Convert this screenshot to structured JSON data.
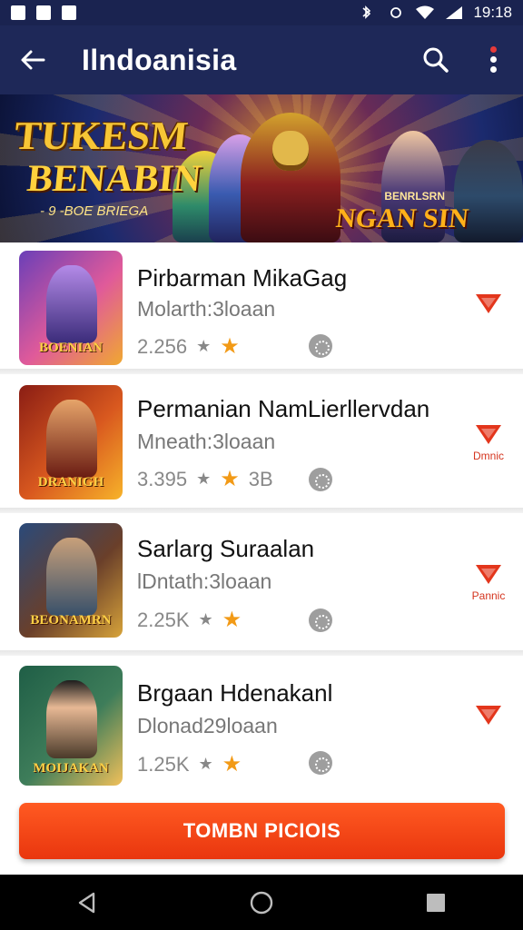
{
  "status_bar": {
    "time": "19:18"
  },
  "app_bar": {
    "title": "Ilndoanisia"
  },
  "banner": {
    "title_line1": "TUKESM",
    "title_line2": "BENABIN",
    "subtitle": "- 9 -BOE BRIEGA",
    "badge_small": "BENRLSRN",
    "badge_large": "NGAN SIN"
  },
  "games": [
    {
      "title": "Pirbarman MikaGag",
      "subtitle": "Molarth:3loaan",
      "rating": "2.256",
      "extra": "",
      "thumb_label": "BOENIAN",
      "tag_label": "",
      "colors": [
        "#6a3fb8",
        "#e05a9a",
        "#f0a830"
      ]
    },
    {
      "title": "Permanian NamLierllervdan",
      "subtitle": "Mneath:3loaan",
      "rating": "3.395",
      "extra": "3B",
      "thumb_label": "DRANIGH",
      "tag_label": "Dmnic",
      "colors": [
        "#8a1d14",
        "#d9591f",
        "#f7b32a"
      ]
    },
    {
      "title": "Sarlarg Suraalan",
      "subtitle": "lDntath:3loaan",
      "rating": "2.25K",
      "extra": "",
      "thumb_label": "BEONAMRN",
      "tag_label": "Pannic",
      "colors": [
        "#2a4a7a",
        "#6a3f2a",
        "#d7a33a"
      ]
    },
    {
      "title": "Brgaan Hdenakanl",
      "subtitle": "Dlonad29loaan",
      "rating": "1.25K",
      "extra": "",
      "thumb_label": "MOIJAKAN",
      "tag_label": "",
      "colors": [
        "#1f5e46",
        "#3e7d5a",
        "#f1c05a"
      ]
    }
  ],
  "cta": {
    "label": "TOMBN PICIOIS"
  },
  "accent": "#e9360e",
  "header_color": "#1e2858"
}
